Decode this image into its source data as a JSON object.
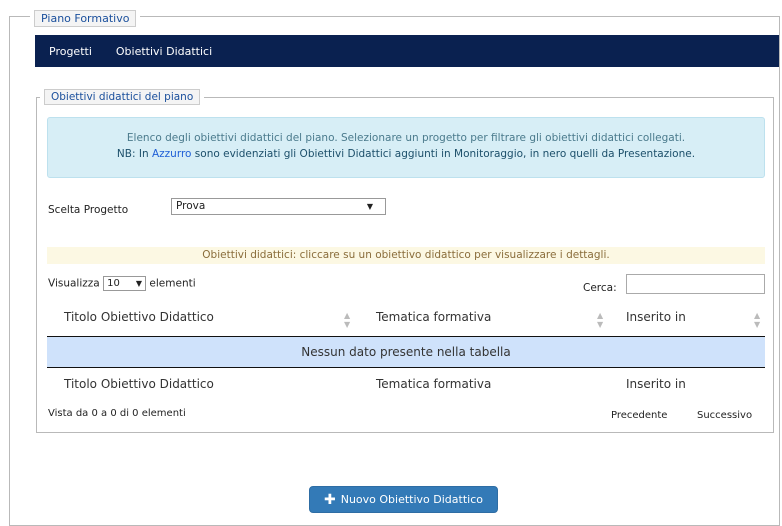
{
  "outer_legend": "Piano Formativo",
  "nav": {
    "items": [
      "Progetti",
      "Obiettivi Didattici"
    ]
  },
  "inner_legend": "Obiettivi didattici del piano",
  "info": {
    "line1": "Elenco degli obiettivi didattici del piano. Selezionare un progetto per filtrare gli obiettivi didattici collegati.",
    "line2_before": "NB: In ",
    "line2_blue": "Azzurro",
    "line2_after": " sono evidenziati gli Obiettivi Didattici aggiunti in Monitoraggio, in nero quelli da Presentazione."
  },
  "progetto": {
    "label": "Scelta Progetto",
    "selected": "Prova"
  },
  "warning": "Obiettivi didattici: cliccare su un obiettivo didattico per visualizzare i dettagli.",
  "table": {
    "show_prefix": "Visualizza",
    "length": "10",
    "show_suffix": "elementi",
    "search_label": "Cerca:",
    "columns": [
      "Titolo Obiettivo Didattico",
      "Tematica formativa",
      "Inserito in"
    ],
    "empty": "Nessun dato presente nella tabella",
    "info": "Vista da 0 a 0 di 0 elementi",
    "prev": "Precedente",
    "next": "Successivo"
  },
  "new_button": "Nuovo Obiettivo Didattico",
  "colors": {
    "navbar": "#0a2150",
    "info_bg": "#d7eef6",
    "warning_bg": "#fcf8e3",
    "empty_row": "#cfe2fb",
    "button": "#337ab7"
  }
}
